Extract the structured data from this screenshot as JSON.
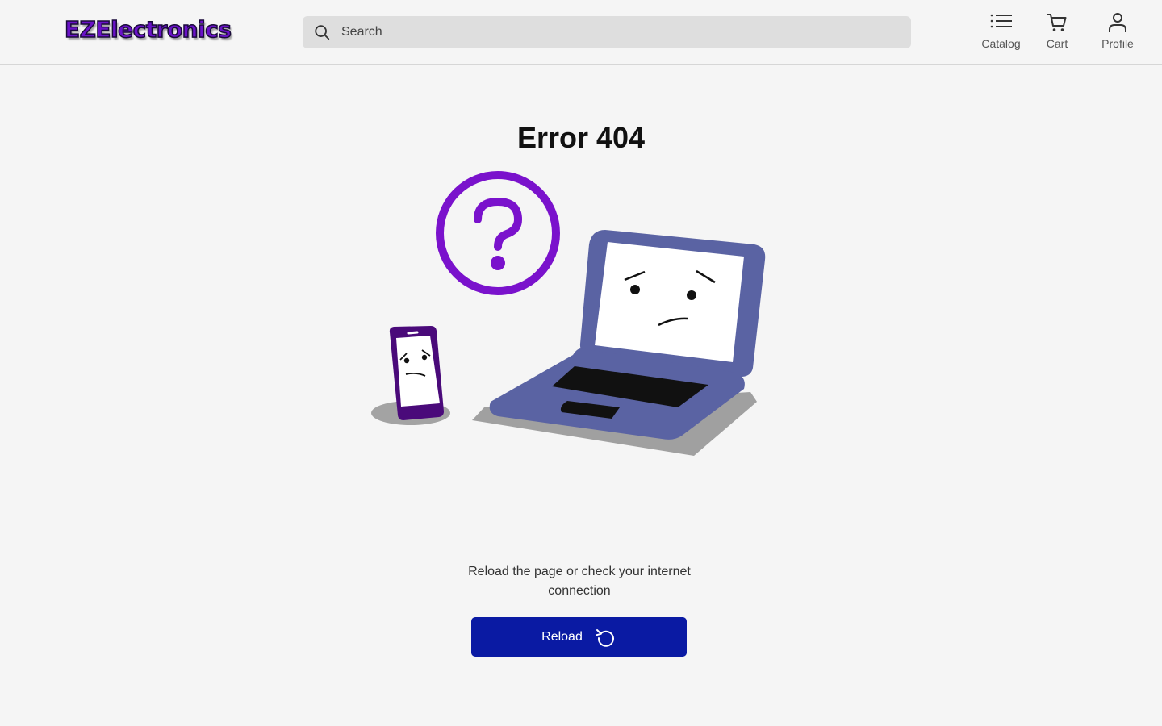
{
  "header": {
    "logo_text": "EZElectronics",
    "search": {
      "placeholder": "Search",
      "value": ""
    },
    "nav": [
      {
        "label": "Catalog",
        "icon": "list-icon"
      },
      {
        "label": "Cart",
        "icon": "cart-icon"
      },
      {
        "label": "Profile",
        "icon": "user-icon"
      }
    ]
  },
  "main": {
    "title": "Error 404",
    "message": "Reload the page or check your internet connection",
    "reload_label": "Reload",
    "reload_icon": "refresh-icon"
  },
  "colors": {
    "accent_button": "#0a1aa3",
    "question_purple": "#7a12cc",
    "laptop_blue": "#5a63a3",
    "phone_purple": "#4a0a7a"
  }
}
